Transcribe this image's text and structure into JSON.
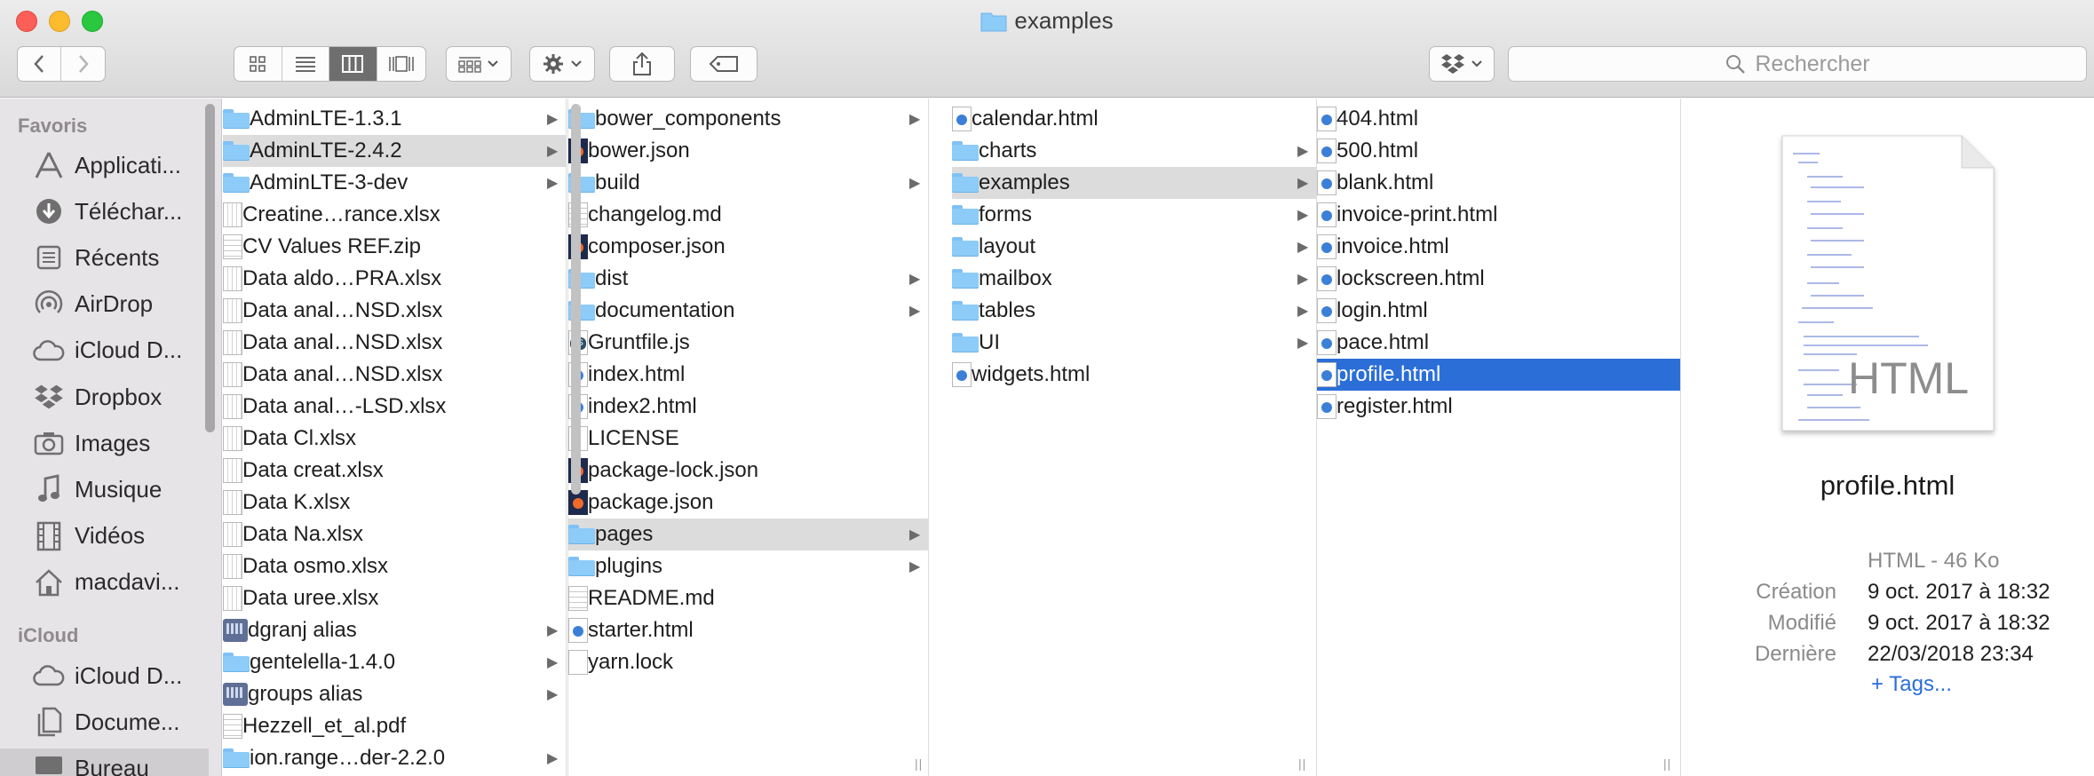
{
  "window": {
    "title": "examples"
  },
  "toolbar": {
    "search_placeholder": "Rechercher"
  },
  "sidebar": {
    "favorites_heading": "Favoris",
    "favorites": [
      {
        "label": "Applicati...",
        "icon": "applications-icon"
      },
      {
        "label": "Téléchar...",
        "icon": "downloads-icon"
      },
      {
        "label": "Récents",
        "icon": "recents-icon"
      },
      {
        "label": "AirDrop",
        "icon": "airdrop-icon"
      },
      {
        "label": "iCloud D...",
        "icon": "icloud-icon"
      },
      {
        "label": "Dropbox",
        "icon": "dropbox-icon"
      },
      {
        "label": "Images",
        "icon": "camera-icon"
      },
      {
        "label": "Musique",
        "icon": "music-note-icon"
      },
      {
        "label": "Vidéos",
        "icon": "film-icon"
      },
      {
        "label": "macdavi...",
        "icon": "home-icon"
      }
    ],
    "icloud_heading": "iCloud",
    "icloud": [
      {
        "label": "iCloud D...",
        "icon": "icloud-icon"
      },
      {
        "label": "Docume...",
        "icon": "documents-icon"
      },
      {
        "label": "Bureau",
        "icon": "desktop-icon"
      }
    ]
  },
  "columns": [
    {
      "items": [
        {
          "name": "AdminLTE-1.3.1",
          "type": "folder",
          "arrow": true
        },
        {
          "name": "AdminLTE-2.4.2",
          "type": "folder",
          "arrow": true,
          "selected": "grey"
        },
        {
          "name": "AdminLTE-3-dev",
          "type": "folder",
          "arrow": true
        },
        {
          "name": "Creatine…rance.xlsx",
          "type": "xlsx"
        },
        {
          "name": "CV Values REF.zip",
          "type": "zip"
        },
        {
          "name": "Data aldo…PRA.xlsx",
          "type": "xlsx"
        },
        {
          "name": "Data anal…NSD.xlsx",
          "type": "xlsx"
        },
        {
          "name": "Data anal…NSD.xlsx",
          "type": "xlsx"
        },
        {
          "name": "Data anal…NSD.xlsx",
          "type": "xlsx"
        },
        {
          "name": "Data anal…-LSD.xlsx",
          "type": "xlsx"
        },
        {
          "name": "Data Cl.xlsx",
          "type": "xlsx"
        },
        {
          "name": "Data creat.xlsx",
          "type": "xlsx"
        },
        {
          "name": "Data K.xlsx",
          "type": "xlsx"
        },
        {
          "name": "Data Na.xlsx",
          "type": "xlsx"
        },
        {
          "name": "Data osmo.xlsx",
          "type": "xlsx"
        },
        {
          "name": "Data uree.xlsx",
          "type": "xlsx"
        },
        {
          "name": "dgranj alias",
          "type": "alias",
          "arrow": true
        },
        {
          "name": "gentelella-1.4.0",
          "type": "folder",
          "arrow": true
        },
        {
          "name": "groups alias",
          "type": "alias",
          "arrow": true
        },
        {
          "name": "Hezzell_et_al.pdf",
          "type": "pdf"
        },
        {
          "name": "ion.range…der-2.2.0",
          "type": "folder",
          "arrow": true
        }
      ]
    },
    {
      "items": [
        {
          "name": "bower_components",
          "type": "folder",
          "arrow": true
        },
        {
          "name": "bower.json",
          "type": "json"
        },
        {
          "name": "build",
          "type": "folder",
          "arrow": true
        },
        {
          "name": "changelog.md",
          "type": "text"
        },
        {
          "name": "composer.json",
          "type": "json"
        },
        {
          "name": "dist",
          "type": "folder",
          "arrow": true
        },
        {
          "name": "documentation",
          "type": "folder",
          "arrow": true
        },
        {
          "name": "Gruntfile.js",
          "type": "js"
        },
        {
          "name": "index.html",
          "type": "html"
        },
        {
          "name": "index2.html",
          "type": "html"
        },
        {
          "name": "LICENSE",
          "type": "blank"
        },
        {
          "name": "package-lock.json",
          "type": "json"
        },
        {
          "name": "package.json",
          "type": "json"
        },
        {
          "name": "pages",
          "type": "folder",
          "arrow": true,
          "selected": "grey"
        },
        {
          "name": "plugins",
          "type": "folder",
          "arrow": true
        },
        {
          "name": "README.md",
          "type": "text"
        },
        {
          "name": "starter.html",
          "type": "html"
        },
        {
          "name": "yarn.lock",
          "type": "blank"
        }
      ]
    },
    {
      "items": [
        {
          "name": "calendar.html",
          "type": "html"
        },
        {
          "name": "charts",
          "type": "folder",
          "arrow": true
        },
        {
          "name": "examples",
          "type": "folder",
          "arrow": true,
          "selected": "grey"
        },
        {
          "name": "forms",
          "type": "folder",
          "arrow": true
        },
        {
          "name": "layout",
          "type": "folder",
          "arrow": true
        },
        {
          "name": "mailbox",
          "type": "folder",
          "arrow": true
        },
        {
          "name": "tables",
          "type": "folder",
          "arrow": true
        },
        {
          "name": "UI",
          "type": "folder",
          "arrow": true
        },
        {
          "name": "widgets.html",
          "type": "html"
        }
      ]
    },
    {
      "items": [
        {
          "name": "404.html",
          "type": "html"
        },
        {
          "name": "500.html",
          "type": "html"
        },
        {
          "name": "blank.html",
          "type": "html"
        },
        {
          "name": "invoice-print.html",
          "type": "html"
        },
        {
          "name": "invoice.html",
          "type": "html"
        },
        {
          "name": "lockscreen.html",
          "type": "html"
        },
        {
          "name": "login.html",
          "type": "html"
        },
        {
          "name": "pace.html",
          "type": "html"
        },
        {
          "name": "profile.html",
          "type": "html",
          "selected": "blue"
        },
        {
          "name": "register.html",
          "type": "html"
        }
      ]
    }
  ],
  "preview": {
    "thumb_label": "HTML",
    "filename": "profile.html",
    "kind": "HTML - 46 Ko",
    "meta": [
      {
        "key": "Création",
        "value": "9 oct. 2017 à 18:32"
      },
      {
        "key": "Modifié",
        "value": "9 oct. 2017 à 18:32"
      },
      {
        "key": "Dernière",
        "value": "22/03/2018 23:34"
      }
    ],
    "tags_link": "+ Tags..."
  },
  "colors": {
    "selection_blue": "#2b6ed8",
    "selection_grey": "#dcdcdc",
    "folder_blue": "#8dcbf8"
  }
}
